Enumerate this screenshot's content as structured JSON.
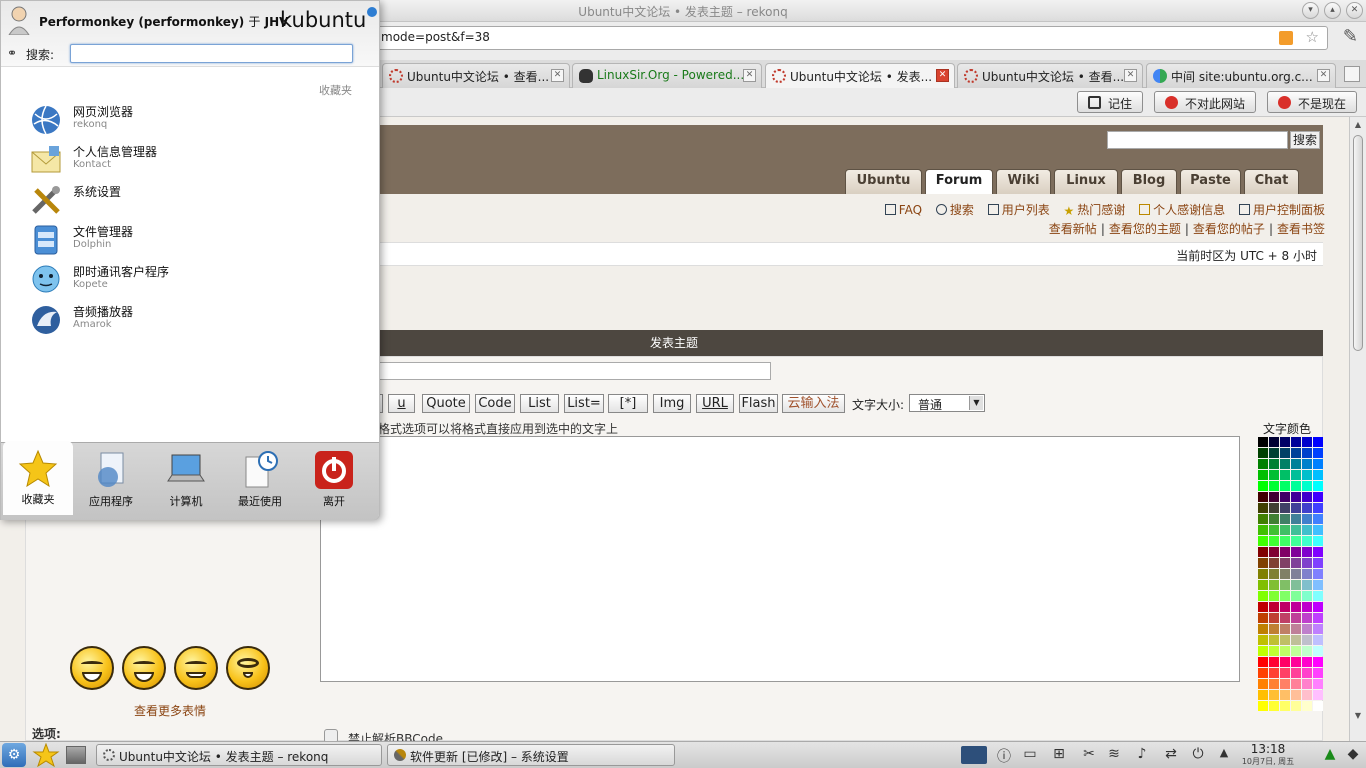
{
  "window": {
    "title": "Ubuntu中文论坛 • 发表主题 – rekonq",
    "url": "http://forum.ubuntu.org.cn/posting.php?mode=post&f=38",
    "url_visible": "mode=post&f=38"
  },
  "tabs": [
    {
      "label": "Ubuntu中文论坛 • 查看..."
    },
    {
      "label": "LinuxSir.Org - Powered..."
    },
    {
      "label": "Ubuntu中文论坛 • 发表..."
    },
    {
      "label": "Ubuntu中文论坛 • 查看..."
    },
    {
      "label": "中间 site:ubuntu.org.c..."
    }
  ],
  "webbar": {
    "remember": "记住",
    "never": "不对此网站",
    "not_now": "不是现在"
  },
  "forum": {
    "search_button": "搜索",
    "nav_tabs": [
      "Ubuntu",
      "Forum",
      "Wiki",
      "Linux",
      "Blog",
      "Paste",
      "Chat"
    ],
    "links_row1": [
      "FAQ",
      "搜索",
      "用户列表",
      "热门感谢",
      "个人感谢信息",
      "用户控制面板"
    ],
    "links_row2": [
      "查看新帖",
      "查看您的主题",
      "查看您的帖子",
      "查看书签"
    ],
    "timezone": "当前时区为 UTC + 8 小时",
    "post_title": "发表主题",
    "bbcode_buttons": [
      "u",
      "Quote",
      "Code",
      "List",
      "List=",
      "[*]",
      "Img",
      "URL",
      "Flash",
      "云输入法"
    ],
    "font_size_label": "文字大小:",
    "font_size_value": "普通",
    "hint": "格式选项可以将格式直接应用到选中的文字上",
    "color_title": "文字颜色",
    "more_smilies": "查看更多表情",
    "options_label": "选项:",
    "disable_bbcode": "禁止解析BBCode"
  },
  "kickoff": {
    "user": "Performonkey (performonkey)",
    "at": "于",
    "host": "JHV",
    "logo": "kubuntu",
    "search_label": "搜索:",
    "section": "收藏夹",
    "favorites": [
      {
        "name": "网页浏览器",
        "sub": "rekonq",
        "icon": "globe-icon"
      },
      {
        "name": "个人信息管理器",
        "sub": "Kontact",
        "icon": "contact-icon"
      },
      {
        "name": "系统设置",
        "sub": "",
        "icon": "tools-icon"
      },
      {
        "name": "文件管理器",
        "sub": "Dolphin",
        "icon": "folder-icon"
      },
      {
        "name": "即时通讯客户程序",
        "sub": "Kopete",
        "icon": "chat-icon"
      },
      {
        "name": "音频播放器",
        "sub": "Amarok",
        "icon": "amarok-icon"
      }
    ],
    "tabs": [
      {
        "label": "收藏夹",
        "icon": "star-icon"
      },
      {
        "label": "应用程序",
        "icon": "applications-icon"
      },
      {
        "label": "计算机",
        "icon": "computer-icon"
      },
      {
        "label": "最近使用",
        "icon": "recent-icon"
      },
      {
        "label": "离开",
        "icon": "power-icon"
      }
    ]
  },
  "taskbar": {
    "tasks": [
      "Ubuntu中文论坛 • 发表主题 – rekonq",
      "软件更新 [已修改] – 系统设置"
    ],
    "time": "13:18",
    "date": "10月7日, 周五"
  },
  "colors": {
    "forum_brown": "#7d6d5c",
    "post_header": "#4d4740",
    "link": "#8b4513",
    "accent_blue": "#2d7dd2"
  }
}
